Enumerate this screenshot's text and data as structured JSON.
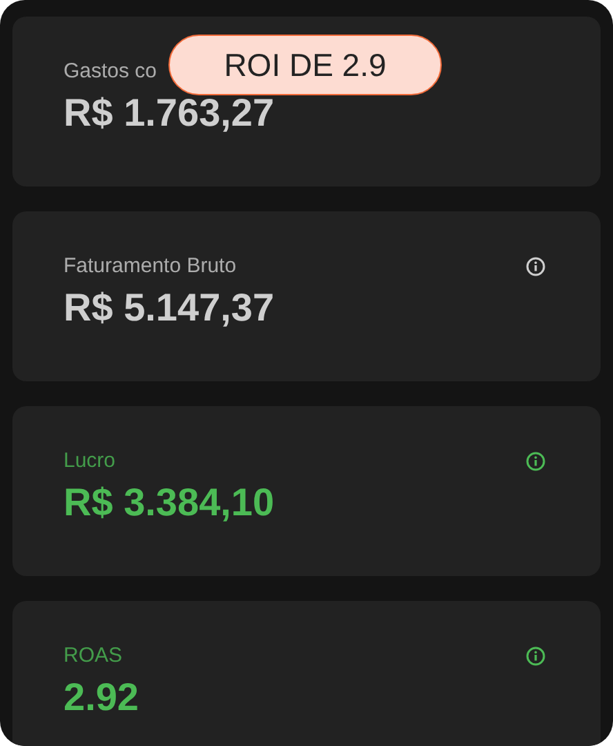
{
  "badge": {
    "text": "ROI DE 2.9"
  },
  "cards": [
    {
      "label": "Gastos co",
      "value": "R$ 1.763,27",
      "color": "#cfcfcf",
      "info_icon": false
    },
    {
      "label": "Faturamento Bruto",
      "value": "R$ 5.147,37",
      "color": "#cfcfcf",
      "info_icon": true
    },
    {
      "label": "Lucro",
      "value": "R$ 3.384,10",
      "color": "#4cbb55",
      "info_icon": true
    },
    {
      "label": "ROAS",
      "value": "2.92",
      "color": "#4cbb55",
      "info_icon": true
    }
  ]
}
